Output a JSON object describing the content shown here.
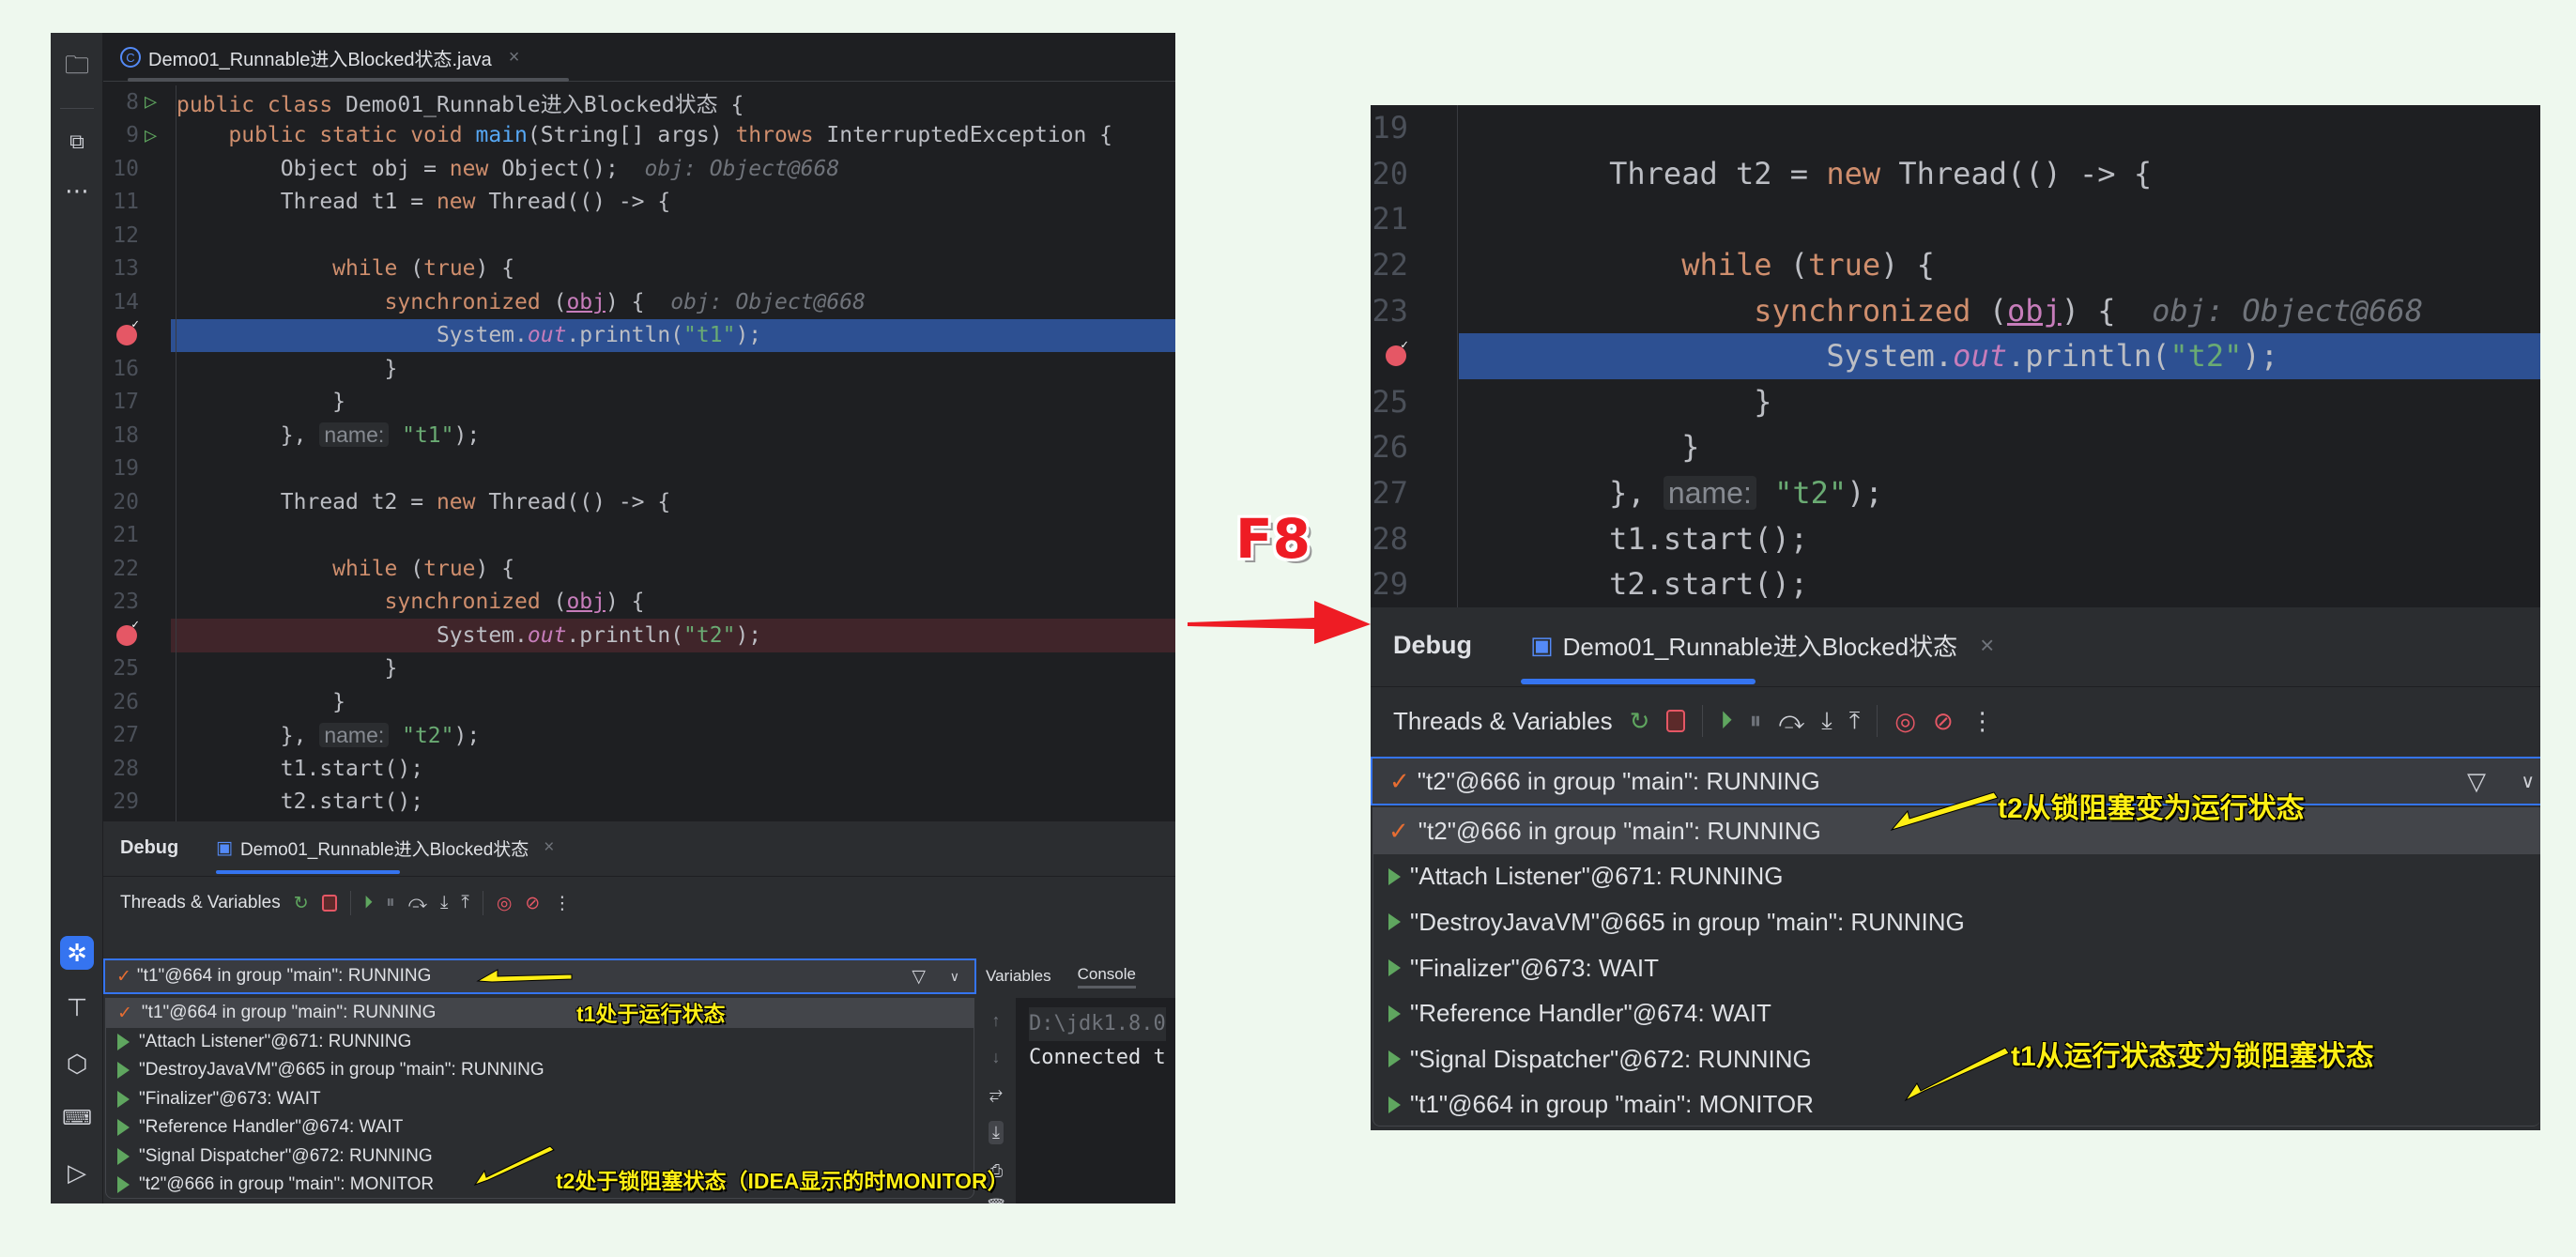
{
  "left": {
    "file_tab": {
      "icon": "class-icon",
      "label": "Demo01_Runnable进入Blocked状态.java",
      "close": "×"
    },
    "code_lines": [
      {
        "n": "8",
        "run": true,
        "segs": [
          [
            "kw",
            "public class "
          ],
          [
            "",
            "Demo01_Runnable进入Blocked状态 {"
          ]
        ]
      },
      {
        "n": "9",
        "run": true,
        "segs": [
          [
            "",
            "    "
          ],
          [
            "kw",
            "public static void "
          ],
          [
            "fn",
            "main"
          ],
          [
            "",
            "(String[] args) "
          ],
          [
            "kw",
            "throws "
          ],
          [
            "",
            "InterruptedException {"
          ]
        ]
      },
      {
        "n": "10",
        "segs": [
          [
            "",
            "        Object obj = "
          ],
          [
            "kw",
            "new "
          ],
          [
            "",
            "Object();  "
          ],
          [
            "hint",
            "obj: Object@668"
          ]
        ]
      },
      {
        "n": "11",
        "segs": [
          [
            "",
            "        Thread t1 = "
          ],
          [
            "kw",
            "new "
          ],
          [
            "",
            "Thread(() -> {"
          ]
        ]
      },
      {
        "n": "12",
        "segs": [
          [
            "",
            ""
          ]
        ]
      },
      {
        "n": "13",
        "segs": [
          [
            "",
            "            "
          ],
          [
            "kw",
            "while "
          ],
          [
            "",
            "("
          ],
          [
            "kw",
            "true"
          ],
          [
            "",
            ") {"
          ]
        ]
      },
      {
        "n": "14",
        "segs": [
          [
            "",
            "                "
          ],
          [
            "kw",
            "synchronized "
          ],
          [
            "",
            "("
          ],
          [
            "ul",
            "obj"
          ],
          [
            "",
            ") {  "
          ],
          [
            "hint",
            "obj: Object@668"
          ]
        ]
      },
      {
        "n": "15",
        "bp": true,
        "hl": "blue",
        "segs": [
          [
            "",
            "                    System."
          ],
          [
            "st",
            "out"
          ],
          [
            "",
            ".println("
          ],
          [
            "str",
            "\"t1\""
          ],
          [
            "",
            ");"
          ]
        ]
      },
      {
        "n": "16",
        "segs": [
          [
            "",
            "                }"
          ]
        ]
      },
      {
        "n": "17",
        "segs": [
          [
            "",
            "            }"
          ]
        ]
      },
      {
        "n": "18",
        "segs": [
          [
            "",
            "        }, "
          ],
          [
            "chip",
            "name:"
          ],
          [
            "str",
            " \"t1\""
          ],
          [
            "",
            ");"
          ]
        ]
      },
      {
        "n": "19",
        "segs": [
          [
            "",
            ""
          ]
        ]
      },
      {
        "n": "20",
        "segs": [
          [
            "",
            "        Thread t2 = "
          ],
          [
            "kw",
            "new "
          ],
          [
            "",
            "Thread(() -> {"
          ]
        ]
      },
      {
        "n": "21",
        "segs": [
          [
            "",
            ""
          ]
        ]
      },
      {
        "n": "22",
        "segs": [
          [
            "",
            "            "
          ],
          [
            "kw",
            "while "
          ],
          [
            "",
            "("
          ],
          [
            "kw",
            "true"
          ],
          [
            "",
            ") {"
          ]
        ]
      },
      {
        "n": "23",
        "segs": [
          [
            "",
            "                "
          ],
          [
            "kw",
            "synchronized "
          ],
          [
            "",
            "("
          ],
          [
            "ul",
            "obj"
          ],
          [
            "",
            ") {"
          ]
        ]
      },
      {
        "n": "24",
        "bp": true,
        "hl": "red",
        "segs": [
          [
            "",
            "                    System."
          ],
          [
            "st",
            "out"
          ],
          [
            "",
            ".println("
          ],
          [
            "str",
            "\"t2\""
          ],
          [
            "",
            ");"
          ]
        ]
      },
      {
        "n": "25",
        "segs": [
          [
            "",
            "                }"
          ]
        ]
      },
      {
        "n": "26",
        "segs": [
          [
            "",
            "            }"
          ]
        ]
      },
      {
        "n": "27",
        "segs": [
          [
            "",
            "        }, "
          ],
          [
            "chip",
            "name:"
          ],
          [
            "str",
            " \"t2\""
          ],
          [
            "",
            ");"
          ]
        ]
      },
      {
        "n": "28",
        "segs": [
          [
            "",
            "        t1.start();"
          ]
        ]
      },
      {
        "n": "29",
        "segs": [
          [
            "",
            "        t2.start();"
          ]
        ]
      }
    ],
    "debug": {
      "title": "Debug",
      "session_tab": "Demo01_Runnable进入Blocked状态",
      "close": "×",
      "toolbar_label": "Threads & Variables",
      "combo_value": "\"t1\"@664 in group \"main\": RUNNING",
      "side_tabs": [
        "Variables",
        "Console"
      ],
      "console_lines": [
        "D:\\jdk1.8.0",
        "Connected t"
      ],
      "threads": [
        {
          "label": "\"t1\"@664 in group \"main\": RUNNING",
          "current": true
        },
        {
          "label": "\"Attach Listener\"@671: RUNNING"
        },
        {
          "label": "\"DestroyJavaVM\"@665 in group \"main\": RUNNING"
        },
        {
          "label": "\"Finalizer\"@673: WAIT"
        },
        {
          "label": "\"Reference Handler\"@674: WAIT"
        },
        {
          "label": "\"Signal Dispatcher\"@672: RUNNING"
        },
        {
          "label": "\"t2\"@666 in group \"main\": MONITOR"
        }
      ]
    },
    "annotations": [
      "t1处于运行状态",
      "t2处于锁阻塞状态（IDEA显示的时MONITOR）"
    ]
  },
  "transition": {
    "key_label": "F8",
    "arrow_color": "#ee1c24"
  },
  "right": {
    "code_lines": [
      {
        "n": "19",
        "segs": [
          [
            "",
            ""
          ]
        ]
      },
      {
        "n": "20",
        "segs": [
          [
            "",
            "        Thread t2 = "
          ],
          [
            "kw",
            "new "
          ],
          [
            "",
            "Thread(() -> {"
          ]
        ]
      },
      {
        "n": "21",
        "segs": [
          [
            "",
            ""
          ]
        ]
      },
      {
        "n": "22",
        "segs": [
          [
            "",
            "            "
          ],
          [
            "kw",
            "while "
          ],
          [
            "",
            "("
          ],
          [
            "kw",
            "true"
          ],
          [
            "",
            ") {"
          ]
        ]
      },
      {
        "n": "23",
        "segs": [
          [
            "",
            "                "
          ],
          [
            "kw",
            "synchronized "
          ],
          [
            "",
            "("
          ],
          [
            "ul",
            "obj"
          ],
          [
            "",
            ") {  "
          ],
          [
            "hint",
            "obj: Object@668"
          ]
        ]
      },
      {
        "n": "24",
        "bp": true,
        "hl": "blue",
        "segs": [
          [
            "",
            "                    System."
          ],
          [
            "st",
            "out"
          ],
          [
            "",
            ".println("
          ],
          [
            "str",
            "\"t2\""
          ],
          [
            "",
            ");"
          ]
        ]
      },
      {
        "n": "25",
        "segs": [
          [
            "",
            "                }"
          ]
        ]
      },
      {
        "n": "26",
        "segs": [
          [
            "",
            "            }"
          ]
        ]
      },
      {
        "n": "27",
        "segs": [
          [
            "",
            "        }, "
          ],
          [
            "chip",
            "name:"
          ],
          [
            "str",
            " \"t2\""
          ],
          [
            "",
            ");"
          ]
        ]
      },
      {
        "n": "28",
        "segs": [
          [
            "",
            "        t1.start();"
          ]
        ]
      },
      {
        "n": "29",
        "segs": [
          [
            "",
            "        t2.start();"
          ]
        ]
      }
    ],
    "debug": {
      "title": "Debug",
      "session_tab": "Demo01_Runnable进入Blocked状态",
      "close": "×",
      "toolbar_label": "Threads & Variables",
      "combo_value": "\"t2\"@666 in group \"main\": RUNNING",
      "threads": [
        {
          "label": "\"t2\"@666 in group \"main\": RUNNING",
          "current": true
        },
        {
          "label": "\"Attach Listener\"@671: RUNNING"
        },
        {
          "label": "\"DestroyJavaVM\"@665 in group \"main\": RUNNING"
        },
        {
          "label": "\"Finalizer\"@673: WAIT"
        },
        {
          "label": "\"Reference Handler\"@674: WAIT"
        },
        {
          "label": "\"Signal Dispatcher\"@672: RUNNING"
        },
        {
          "label": "\"t1\"@664 in group \"main\": MONITOR"
        }
      ]
    },
    "annotations": [
      "t2从锁阻塞变为运行状态",
      "t1从运行状态变为锁阻塞状态"
    ]
  },
  "colors": {
    "accent": "#3574f0",
    "breakpoint": "#e55765",
    "exec_line": "#2d5092",
    "annotation": "#ffef14"
  }
}
